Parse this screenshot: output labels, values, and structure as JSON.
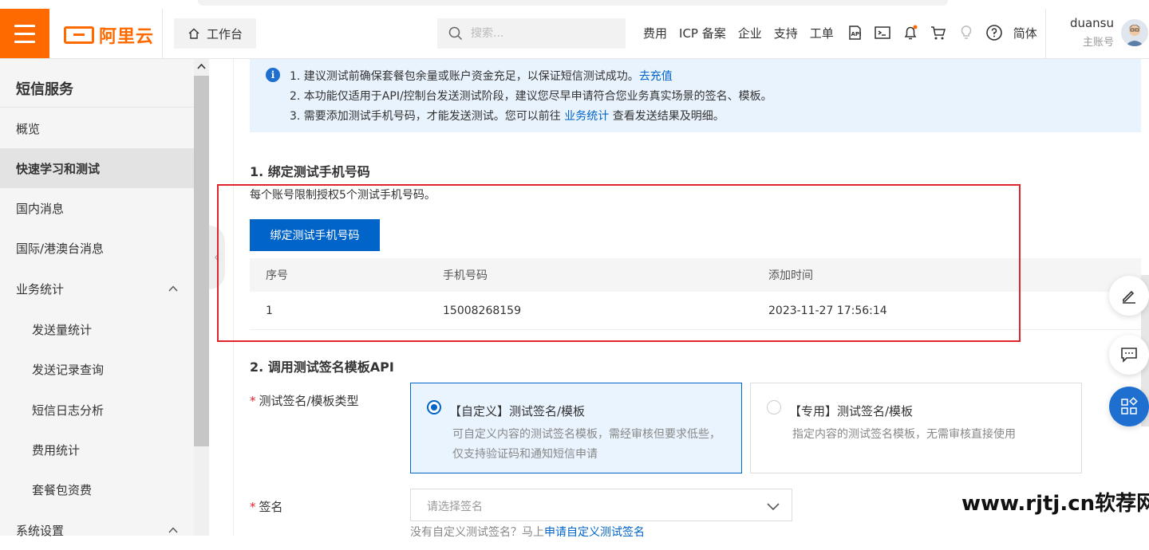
{
  "header": {
    "logo_text": "阿里云",
    "workbench_label": "工作台",
    "search_placeholder": "搜索...",
    "links": [
      "费用",
      "ICP 备案",
      "企业",
      "支持",
      "工单"
    ],
    "lang_label": "简体",
    "user_name": "duansu",
    "user_role": "主账号"
  },
  "sidebar": {
    "title": "短信服务",
    "items": [
      {
        "label": "概览"
      },
      {
        "label": "快速学习和测试"
      },
      {
        "label": "国内消息"
      },
      {
        "label": "国际/港澳台消息"
      },
      {
        "label": "业务统计"
      },
      {
        "label": "发送量统计"
      },
      {
        "label": "发送记录查询"
      },
      {
        "label": "短信日志分析"
      },
      {
        "label": "费用统计"
      },
      {
        "label": "套餐包资费"
      },
      {
        "label": "系统设置"
      }
    ]
  },
  "notice": {
    "line1_text": "1. 建议测试前确保套餐包余量或账户资金充足，以保证短信测试成功。",
    "line1_link": "去充值",
    "line2_text": "2. 本功能仅适用于API/控制台发送测试阶段，建议您尽早申请符合您业务真实场景的签名、模板。",
    "line3_pre": "3. 需要添加测试手机号码，才能发送测试。您可以前往 ",
    "line3_link": "业务统计",
    "line3_post": " 查看发送结果及明细。"
  },
  "section1": {
    "title": "1. 绑定测试手机号码",
    "desc": "每个账号限制授权5个测试手机号码。",
    "bind_button": "绑定测试手机号码",
    "table": {
      "headers": [
        "序号",
        "手机号码",
        "添加时间"
      ],
      "rows": [
        [
          "1",
          "15008268159",
          "2023-11-27 17:56:14"
        ]
      ]
    }
  },
  "section2": {
    "title": "2. 调用测试签名模板API",
    "type_label": "测试签名/模板类型",
    "option_custom": {
      "title": "【自定义】测试签名/模板",
      "desc": "可自定义内容的测试签名模板，需经审核但要求低些，仅支持验证码和通知短信申请",
      "selected": true
    },
    "option_dedicated": {
      "title": "【专用】测试签名/模板",
      "desc": "指定内容的测试签名模板，无需审核直接使用",
      "selected": false
    },
    "sign_label": "签名",
    "sign_placeholder": "请选择签名",
    "hint_text": "没有自定义测试签名？马上",
    "hint_link": "申请自定义测试签名"
  },
  "watermark": "www.rjtj.cn软荐网",
  "colors": {
    "brand_orange": "#ff6a00",
    "primary_blue": "#0064c8",
    "highlight_red": "#e0242b"
  }
}
